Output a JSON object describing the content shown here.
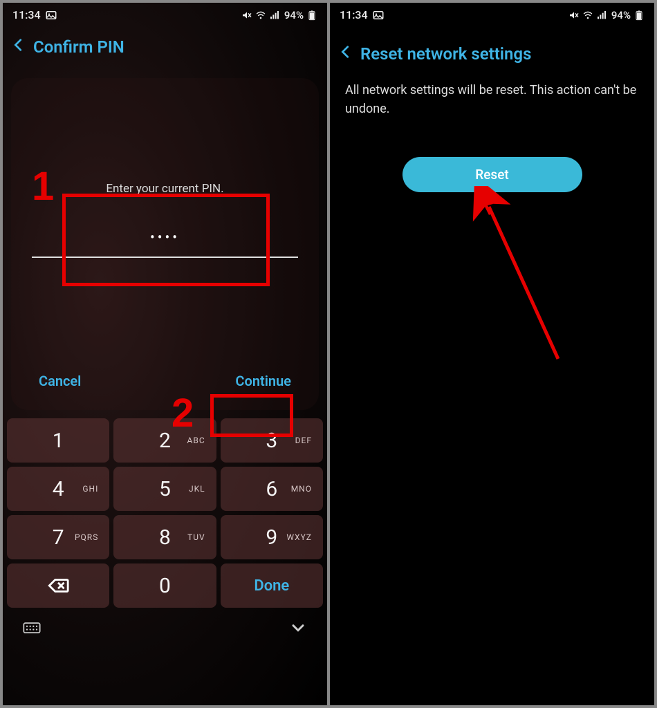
{
  "status": {
    "time": "11:34",
    "battery": "94%"
  },
  "left": {
    "title": "Confirm PIN",
    "prompt": "Enter your current PIN.",
    "dots": "••••",
    "cancel": "Cancel",
    "continue": "Continue",
    "keys": [
      {
        "n": "1",
        "s": ""
      },
      {
        "n": "2",
        "s": "ABC"
      },
      {
        "n": "3",
        "s": "DEF"
      },
      {
        "n": "4",
        "s": "GHI"
      },
      {
        "n": "5",
        "s": "JKL"
      },
      {
        "n": "6",
        "s": "MNO"
      },
      {
        "n": "7",
        "s": "PQRS"
      },
      {
        "n": "8",
        "s": "TUV"
      },
      {
        "n": "9",
        "s": "WXYZ"
      },
      {
        "n": "back",
        "s": ""
      },
      {
        "n": "0",
        "s": ""
      },
      {
        "n": "Done",
        "s": ""
      }
    ]
  },
  "right": {
    "title": "Reset network settings",
    "body": "All network settings will be reset. This action can't be undone.",
    "reset": "Reset"
  },
  "annotations": {
    "label1": "1",
    "label2": "2"
  }
}
